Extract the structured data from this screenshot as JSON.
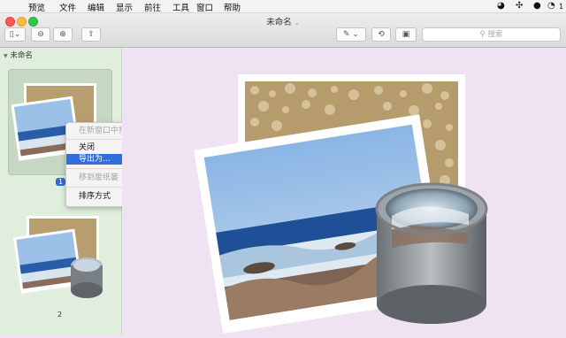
{
  "menubar": {
    "apple_icon": "apple-icon",
    "items": [
      "预览",
      "文件",
      "编辑",
      "显示",
      "前往",
      "工具",
      "窗口",
      "帮助"
    ],
    "status_num": "1"
  },
  "window": {
    "title": "未命名",
    "search_placeholder": "搜索"
  },
  "sidebar": {
    "header": "未命名",
    "pages": [
      {
        "number": "1"
      },
      {
        "number": "2"
      }
    ]
  },
  "context_menu": {
    "items": [
      {
        "label": "在新窗口中打开",
        "disabled": true
      },
      {
        "label": "关闭",
        "disabled": false
      },
      {
        "label": "导出为...",
        "highlighted": true
      },
      {
        "label": "移到废纸篓",
        "disabled": true
      },
      {
        "label": "排序方式",
        "submenu": true
      }
    ]
  },
  "colors": {
    "accent": "#2f6edb",
    "sidebar_bg": "#dfeedd",
    "canvas_bg": "#efe2f2",
    "arrow": "#e03030"
  }
}
